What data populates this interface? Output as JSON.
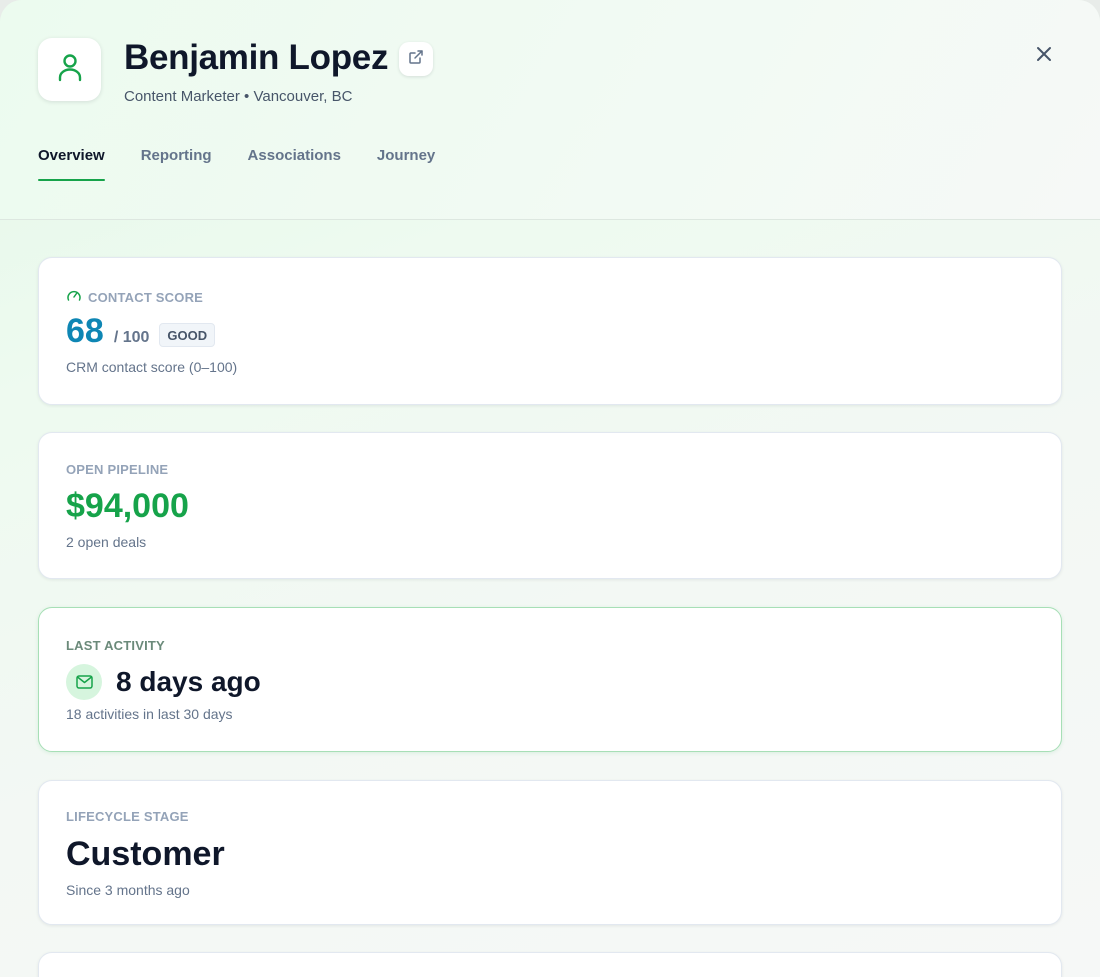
{
  "contact": {
    "name": "Benjamin Lopez",
    "subtitle": "Content Marketer • Vancouver, BC"
  },
  "tabs": [
    {
      "label": "Overview",
      "active": true
    },
    {
      "label": "Reporting",
      "active": false
    },
    {
      "label": "Associations",
      "active": false
    },
    {
      "label": "Journey",
      "active": false
    }
  ],
  "cards": {
    "contact_score": {
      "label": "CONTACT SCORE",
      "value": "68",
      "max": "/ 100",
      "badge": "GOOD",
      "description": "CRM contact score (0–100)"
    },
    "open_pipeline": {
      "label": "OPEN PIPELINE",
      "value": "$94,000",
      "description": "2 open deals"
    },
    "last_activity": {
      "label": "LAST ACTIVITY",
      "value": "8 days ago",
      "description": "18 activities in last 30 days"
    },
    "lifecycle_stage": {
      "label": "LIFECYCLE STAGE",
      "value": "Customer",
      "description": "Since 3 months ago"
    }
  },
  "icons": {
    "avatar": "user-icon",
    "open_external": "external-link-icon",
    "close": "close-icon",
    "score": "gauge-icon",
    "activity": "mail-icon"
  },
  "colors": {
    "accent_green": "#16a34a",
    "score_blue": "#0e86b4"
  }
}
